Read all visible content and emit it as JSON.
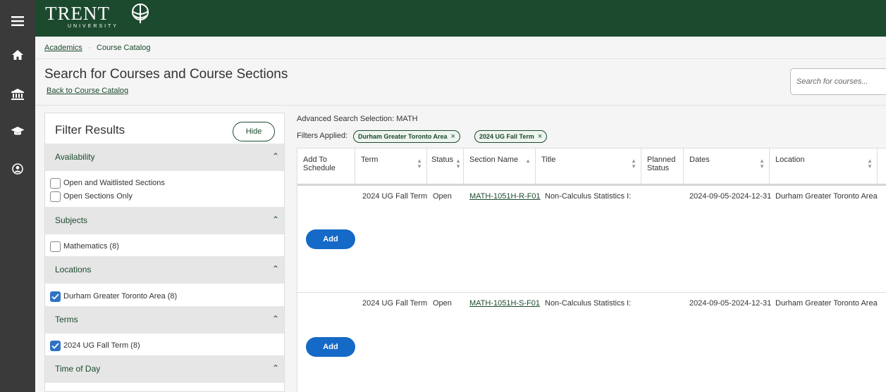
{
  "rail": {
    "icons": [
      "menu-icon",
      "home-icon",
      "bank-icon",
      "graduation-cap-icon",
      "user-icon"
    ]
  },
  "brand": {
    "name": "TRENT",
    "sub": "UNIVERSITY"
  },
  "breadcrumb": {
    "first": "Academics",
    "separator": "·",
    "current": "Course Catalog"
  },
  "header": {
    "title": "Search for Courses and Course Sections",
    "back_link": "Back to Course Catalog",
    "search_placeholder": "Search for courses..."
  },
  "filter": {
    "title": "Filter Results",
    "hide_label": "Hide",
    "sections": {
      "availability": {
        "label": "Availability",
        "options": [
          "Open and Waitlisted Sections",
          "Open Sections Only"
        ]
      },
      "subjects": {
        "label": "Subjects",
        "options": [
          "Mathematics (8)"
        ]
      },
      "locations": {
        "label": "Locations",
        "options": [
          "Durham Greater Toronto Area (8)"
        ]
      },
      "terms": {
        "label": "Terms",
        "options": [
          "2024 UG Fall Term (8)"
        ]
      },
      "time_of_day": {
        "label": "Time of Day"
      }
    }
  },
  "results": {
    "advanced_selection": "Advanced Search Selection: MATH",
    "filters_applied_label": "Filters Applied:",
    "chips": [
      "Durham Greater Toronto Area",
      "2024 UG Fall Term"
    ],
    "columns": {
      "add_to_schedule": "Add To Schedule",
      "term": "Term",
      "status": "Status",
      "section_name": "Section Name",
      "title": "Title",
      "planned_status": "Planned Status",
      "dates": "Dates",
      "location": "Location"
    },
    "add_label": "Add",
    "rows": [
      {
        "term": "2024 UG Fall Term",
        "status": "Open",
        "section": "MATH-1051H-R-F01",
        "title": "Non-Calculus Statistics I:",
        "dates": "2024-09-05-2024-12-31",
        "location": "Durham Greater Toronto Area"
      },
      {
        "term": "2024 UG Fall Term",
        "status": "Open",
        "section": "MATH-1051H-S-F01",
        "title": "Non-Calculus Statistics I:",
        "dates": "2024-09-05-2024-12-31",
        "location": "Durham Greater Toronto Area"
      }
    ]
  },
  "colors": {
    "brand_green": "#1c4a2e",
    "rail": "#3a3a3a",
    "add_blue": "#1569c7",
    "check_blue": "#2f72c4"
  }
}
